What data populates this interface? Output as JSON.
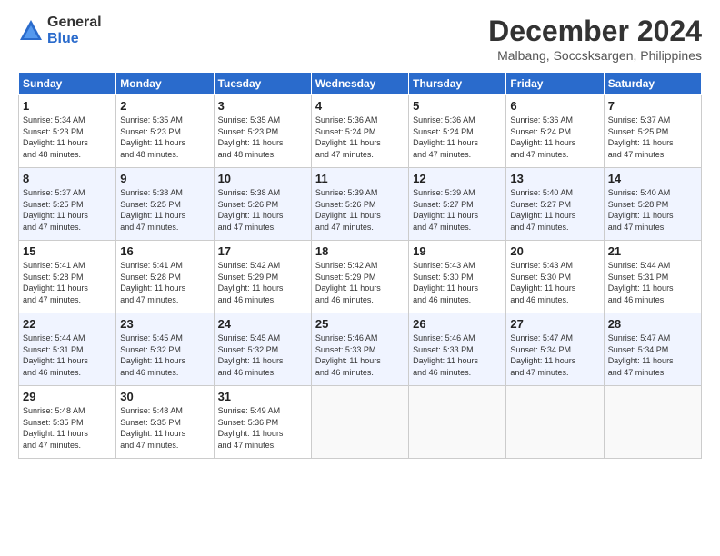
{
  "logo": {
    "general": "General",
    "blue": "Blue"
  },
  "title": "December 2024",
  "subtitle": "Malbang, Soccsksargen, Philippines",
  "days_of_week": [
    "Sunday",
    "Monday",
    "Tuesday",
    "Wednesday",
    "Thursday",
    "Friday",
    "Saturday"
  ],
  "weeks": [
    [
      {
        "day": "1",
        "info": "Sunrise: 5:34 AM\nSunset: 5:23 PM\nDaylight: 11 hours\nand 48 minutes."
      },
      {
        "day": "2",
        "info": "Sunrise: 5:35 AM\nSunset: 5:23 PM\nDaylight: 11 hours\nand 48 minutes."
      },
      {
        "day": "3",
        "info": "Sunrise: 5:35 AM\nSunset: 5:23 PM\nDaylight: 11 hours\nand 48 minutes."
      },
      {
        "day": "4",
        "info": "Sunrise: 5:36 AM\nSunset: 5:24 PM\nDaylight: 11 hours\nand 47 minutes."
      },
      {
        "day": "5",
        "info": "Sunrise: 5:36 AM\nSunset: 5:24 PM\nDaylight: 11 hours\nand 47 minutes."
      },
      {
        "day": "6",
        "info": "Sunrise: 5:36 AM\nSunset: 5:24 PM\nDaylight: 11 hours\nand 47 minutes."
      },
      {
        "day": "7",
        "info": "Sunrise: 5:37 AM\nSunset: 5:25 PM\nDaylight: 11 hours\nand 47 minutes."
      }
    ],
    [
      {
        "day": "8",
        "info": "Sunrise: 5:37 AM\nSunset: 5:25 PM\nDaylight: 11 hours\nand 47 minutes."
      },
      {
        "day": "9",
        "info": "Sunrise: 5:38 AM\nSunset: 5:25 PM\nDaylight: 11 hours\nand 47 minutes."
      },
      {
        "day": "10",
        "info": "Sunrise: 5:38 AM\nSunset: 5:26 PM\nDaylight: 11 hours\nand 47 minutes."
      },
      {
        "day": "11",
        "info": "Sunrise: 5:39 AM\nSunset: 5:26 PM\nDaylight: 11 hours\nand 47 minutes."
      },
      {
        "day": "12",
        "info": "Sunrise: 5:39 AM\nSunset: 5:27 PM\nDaylight: 11 hours\nand 47 minutes."
      },
      {
        "day": "13",
        "info": "Sunrise: 5:40 AM\nSunset: 5:27 PM\nDaylight: 11 hours\nand 47 minutes."
      },
      {
        "day": "14",
        "info": "Sunrise: 5:40 AM\nSunset: 5:28 PM\nDaylight: 11 hours\nand 47 minutes."
      }
    ],
    [
      {
        "day": "15",
        "info": "Sunrise: 5:41 AM\nSunset: 5:28 PM\nDaylight: 11 hours\nand 47 minutes."
      },
      {
        "day": "16",
        "info": "Sunrise: 5:41 AM\nSunset: 5:28 PM\nDaylight: 11 hours\nand 47 minutes."
      },
      {
        "day": "17",
        "info": "Sunrise: 5:42 AM\nSunset: 5:29 PM\nDaylight: 11 hours\nand 46 minutes."
      },
      {
        "day": "18",
        "info": "Sunrise: 5:42 AM\nSunset: 5:29 PM\nDaylight: 11 hours\nand 46 minutes."
      },
      {
        "day": "19",
        "info": "Sunrise: 5:43 AM\nSunset: 5:30 PM\nDaylight: 11 hours\nand 46 minutes."
      },
      {
        "day": "20",
        "info": "Sunrise: 5:43 AM\nSunset: 5:30 PM\nDaylight: 11 hours\nand 46 minutes."
      },
      {
        "day": "21",
        "info": "Sunrise: 5:44 AM\nSunset: 5:31 PM\nDaylight: 11 hours\nand 46 minutes."
      }
    ],
    [
      {
        "day": "22",
        "info": "Sunrise: 5:44 AM\nSunset: 5:31 PM\nDaylight: 11 hours\nand 46 minutes."
      },
      {
        "day": "23",
        "info": "Sunrise: 5:45 AM\nSunset: 5:32 PM\nDaylight: 11 hours\nand 46 minutes."
      },
      {
        "day": "24",
        "info": "Sunrise: 5:45 AM\nSunset: 5:32 PM\nDaylight: 11 hours\nand 46 minutes."
      },
      {
        "day": "25",
        "info": "Sunrise: 5:46 AM\nSunset: 5:33 PM\nDaylight: 11 hours\nand 46 minutes."
      },
      {
        "day": "26",
        "info": "Sunrise: 5:46 AM\nSunset: 5:33 PM\nDaylight: 11 hours\nand 46 minutes."
      },
      {
        "day": "27",
        "info": "Sunrise: 5:47 AM\nSunset: 5:34 PM\nDaylight: 11 hours\nand 47 minutes."
      },
      {
        "day": "28",
        "info": "Sunrise: 5:47 AM\nSunset: 5:34 PM\nDaylight: 11 hours\nand 47 minutes."
      }
    ],
    [
      {
        "day": "29",
        "info": "Sunrise: 5:48 AM\nSunset: 5:35 PM\nDaylight: 11 hours\nand 47 minutes."
      },
      {
        "day": "30",
        "info": "Sunrise: 5:48 AM\nSunset: 5:35 PM\nDaylight: 11 hours\nand 47 minutes."
      },
      {
        "day": "31",
        "info": "Sunrise: 5:49 AM\nSunset: 5:36 PM\nDaylight: 11 hours\nand 47 minutes."
      },
      {
        "day": "",
        "info": ""
      },
      {
        "day": "",
        "info": ""
      },
      {
        "day": "",
        "info": ""
      },
      {
        "day": "",
        "info": ""
      }
    ]
  ]
}
